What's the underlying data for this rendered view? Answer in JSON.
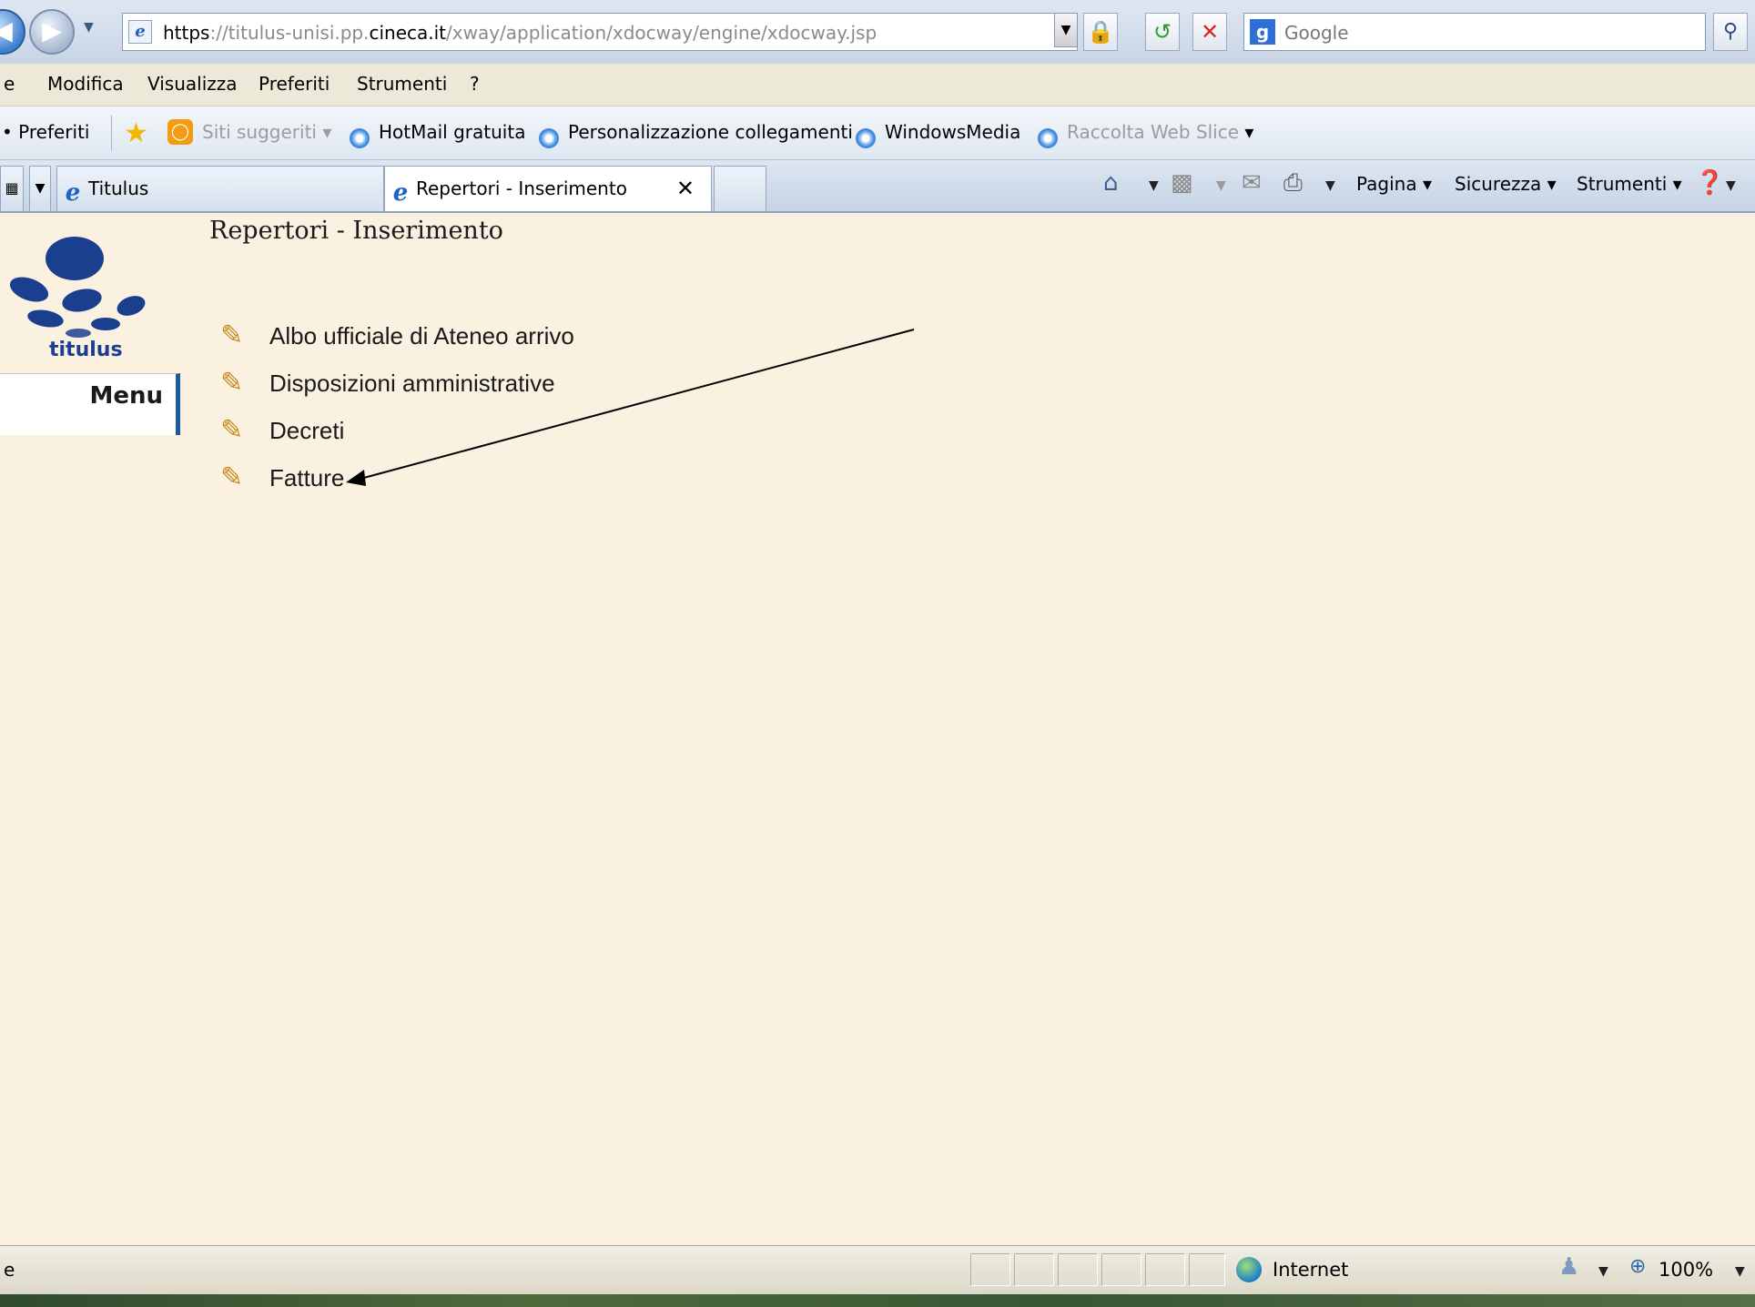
{
  "browser": {
    "url_scheme": "https",
    "url_sep": "://",
    "url_host_pre": "titulus-unisi.pp.",
    "url_host_key": "cineca.it",
    "url_path": "/xway/application/xdocway/engine/xdocway.jsp",
    "search_label": "Google"
  },
  "menubar": {
    "items": [
      {
        "label": "e"
      },
      {
        "label": "Modifica"
      },
      {
        "label": "Visualizza"
      },
      {
        "label": "Preferiti"
      },
      {
        "label": "Strumenti"
      },
      {
        "label": "?"
      }
    ]
  },
  "favorites": {
    "label": "Preferiti",
    "items": [
      {
        "label": "Siti suggeriti"
      },
      {
        "label": "HotMail gratuita"
      },
      {
        "label": "Personalizzazione collegamenti"
      },
      {
        "label": "WindowsMedia"
      },
      {
        "label": "Raccolta Web Slice"
      }
    ]
  },
  "tabs": [
    {
      "label": "Titulus"
    },
    {
      "label": "Repertori - Inserimento"
    }
  ],
  "commandbar": {
    "pagina": "Pagina",
    "sicurezza": "Sicurezza",
    "strumenti": "Strumenti"
  },
  "page": {
    "logo_text": "titulus",
    "menu_label": "Menu",
    "title": "Repertori - Inserimento",
    "repertori": [
      {
        "label": "Albo ufficiale di Ateneo arrivo"
      },
      {
        "label": "Disposizioni amministrative"
      },
      {
        "label": "Decreti"
      },
      {
        "label": "Fatture"
      }
    ]
  },
  "statusbar": {
    "text": "e",
    "zone": "Internet",
    "zoom": "100%"
  },
  "colors": {
    "page_bg": "#fbf1e1",
    "logo_blue": "#1a3f8f",
    "menu_border": "#1c5a9a"
  }
}
